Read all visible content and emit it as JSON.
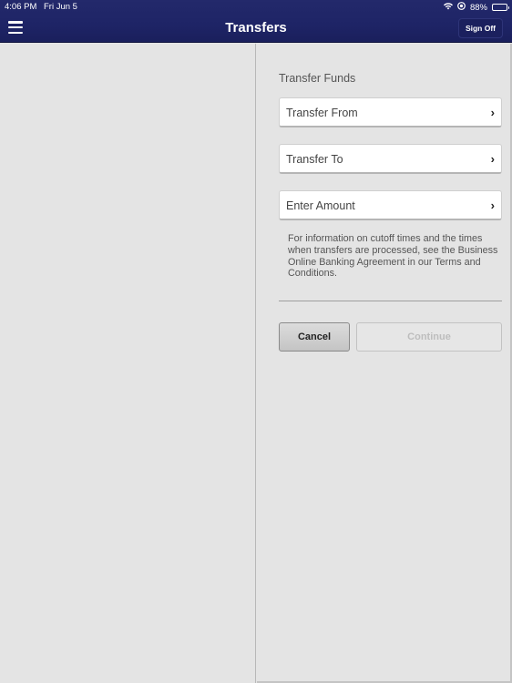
{
  "status_bar": {
    "time": "4:06 PM",
    "date": "Fri Jun 5",
    "battery_percent_label": "88%",
    "battery_level": 0.88,
    "icons": [
      "wifi-icon",
      "location-lock-icon",
      "battery-icon"
    ]
  },
  "header": {
    "title": "Transfers",
    "menu_icon": "hamburger-icon",
    "sign_off_label": "Sign Off",
    "background_color": "#1e2466"
  },
  "form": {
    "section_title": "Transfer Funds",
    "rows": [
      {
        "label": "Transfer From",
        "icon": "chevron-right-icon"
      },
      {
        "label": "Transfer To",
        "icon": "chevron-right-icon"
      },
      {
        "label": "Enter Amount",
        "icon": "chevron-right-icon"
      }
    ],
    "info_text": "For information on cutoff times and the times when transfers are processed, see the Business Online Banking Agreement in our Terms and Conditions.",
    "cancel_label": "Cancel",
    "continue_label": "Continue",
    "continue_enabled": false
  }
}
